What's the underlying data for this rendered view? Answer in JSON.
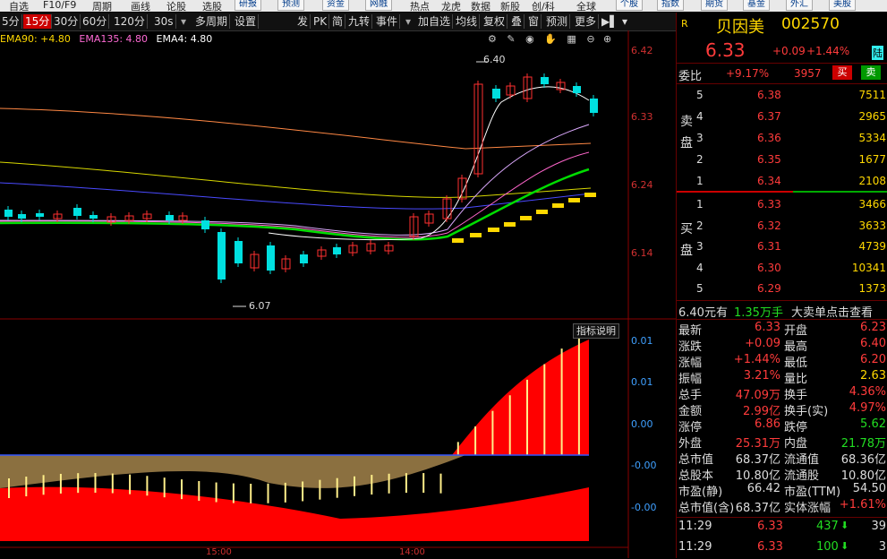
{
  "menubar": {
    "items": [
      "自选",
      "F10/F9",
      "周期",
      "画线",
      "论股",
      "选股"
    ],
    "buttons": [
      "研报",
      "预测",
      "资金",
      "网融"
    ],
    "items2": [
      "热点",
      "龙虎",
      "数据",
      "新股",
      "创/科",
      "全球"
    ],
    "buttons2": [
      "个股",
      "指数",
      "期货",
      "基金",
      "外汇",
      "美股"
    ]
  },
  "toolbar": {
    "periods": [
      "5分",
      "15分",
      "30分",
      "60分",
      "120分",
      "30s"
    ],
    "active_period": "15分",
    "items": [
      "多周期",
      "设置",
      "发",
      "PK",
      "简",
      "九转",
      "事件",
      "加自选",
      "均线",
      "复权",
      "叠",
      "窗",
      "预测",
      "更多"
    ]
  },
  "ema": {
    "ema90": "EMA90: +4.80",
    "ema135": "EMA135: 4.80",
    "ema4": "EMA4: 4.80"
  },
  "chart_data": {
    "type": "line",
    "title": "",
    "price_axis": [
      "6.42",
      "6.33",
      "6.24",
      "6.14"
    ],
    "high_label": "6.40",
    "low_label": "6.07",
    "indicator_axis": [
      "0.01",
      "0.01",
      "0.00",
      "-0.00",
      "-0.00"
    ],
    "indicator_button": "指标说明",
    "time_axis": [
      "15:00",
      "14:00"
    ],
    "colors": {
      "up": "#ff3030",
      "down": "#00e0e0",
      "indicator_fill": "#ff0000",
      "overlay": "#8b7040",
      "signal_line": "#3355ff"
    }
  },
  "quote": {
    "badge": "R",
    "name": "贝因美",
    "code": "002570",
    "price": "6.33",
    "change": "+0.09",
    "pct": "+1.44%",
    "tag": "陆",
    "weibi_label": "委比",
    "weibi": "+9.17%",
    "weicha": "3957",
    "buy_btn": "买",
    "sell_btn": "卖",
    "sell_label": "卖盘",
    "buy_label": "买盘",
    "sells": [
      {
        "lvl": "5",
        "price": "6.38",
        "vol": "7511"
      },
      {
        "lvl": "4",
        "price": "6.37",
        "vol": "2965"
      },
      {
        "lvl": "3",
        "price": "6.36",
        "vol": "5334"
      },
      {
        "lvl": "2",
        "price": "6.35",
        "vol": "1677"
      },
      {
        "lvl": "1",
        "price": "6.34",
        "vol": "2108"
      }
    ],
    "buys": [
      {
        "lvl": "1",
        "price": "6.33",
        "vol": "3466"
      },
      {
        "lvl": "2",
        "price": "6.32",
        "vol": "3633"
      },
      {
        "lvl": "3",
        "price": "6.31",
        "vol": "4739"
      },
      {
        "lvl": "4",
        "price": "6.30",
        "vol": "10341"
      },
      {
        "lvl": "5",
        "price": "6.29",
        "vol": "1373"
      }
    ],
    "bigorder": {
      "price": "6.40元有",
      "qty": "1.35万手",
      "text": "大卖单点击查看"
    },
    "stats": [
      [
        "最新",
        "6.33",
        "开盘",
        "6.23"
      ],
      [
        "涨跌",
        "+0.09",
        "最高",
        "6.40"
      ],
      [
        "涨幅",
        "+1.44%",
        "最低",
        "6.20"
      ],
      [
        "振幅",
        "3.21%",
        "量比",
        "2.63"
      ],
      [
        "总手",
        "47.09万",
        "换手",
        "4.36%"
      ],
      [
        "金额",
        "2.99亿",
        "换手(实)",
        "4.97%"
      ],
      [
        "涨停",
        "6.86",
        "跌停",
        "5.62"
      ],
      [
        "外盘",
        "25.31万",
        "内盘",
        "21.78万"
      ],
      [
        "总市值",
        "68.37亿",
        "流通值",
        "68.36亿"
      ],
      [
        "总股本",
        "10.80亿",
        "流通股",
        "10.80亿"
      ],
      [
        "市盈(静)",
        "66.42",
        "市盈(TTM)",
        "54.50"
      ],
      [
        "总市值(含)",
        "68.37亿",
        "实体涨幅",
        "+1.61%"
      ]
    ],
    "ticks": [
      {
        "time": "11:29",
        "price": "6.33",
        "vol": "437",
        "n": "39"
      },
      {
        "time": "11:29",
        "price": "6.33",
        "vol": "100",
        "n": "3"
      }
    ]
  }
}
